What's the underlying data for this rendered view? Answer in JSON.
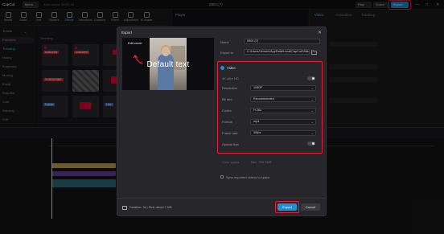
{
  "app": {
    "logo": "CapCut",
    "menu_label": "Menu",
    "autosave": "Auto saved: 18:37:16",
    "document_title": "0904 (7)",
    "play_label": "Play",
    "share_label": "Share",
    "export_label": "Export",
    "window_controls": [
      "—",
      "□",
      "✕"
    ]
  },
  "media_toolbar": {
    "items": [
      "Media",
      "Audio",
      "Text",
      "Stickers",
      "Effects",
      "Transitions",
      "Captions",
      "Filters",
      "Adjustment",
      "AI avatar"
    ],
    "active_index": 4
  },
  "sidebar": {
    "top_label": "Trends",
    "items": [
      "Favorites",
      "Trending",
      "Hobby",
      "Emphasis",
      "Moving",
      "Emoji",
      "Surprise",
      "Cute",
      "Dancing",
      "Y2K"
    ],
    "selected_index": 1
  },
  "effects_grid": {
    "section_label": "Trending",
    "tiles": [
      {
        "label": "subscribe",
        "color": "#3a3a40"
      },
      {
        "label": "subscribe",
        "color": "#333338"
      },
      {
        "label": "",
        "color": "#3a3338"
      },
      {
        "label": "SUBSCRIBE",
        "color": "#2f2f34"
      },
      {
        "label": "",
        "color": "#5a5a5a"
      },
      {
        "label": "",
        "color": "#2f2f34"
      },
      {
        "label": "Follow",
        "color": "#2e3a4a"
      },
      {
        "label": "",
        "color": "#3b2e30"
      },
      {
        "label": "Like",
        "color": "#2f2f34"
      }
    ]
  },
  "player": {
    "label": "Player"
  },
  "right_panel": {
    "tabs": [
      "Video",
      "Animation",
      "Tracking"
    ],
    "selected_tab": 0
  },
  "export_dialog": {
    "title": "Export",
    "close_symbol": "✕",
    "cover_button": "Edit cover",
    "preview_text": "Default text",
    "name_label": "Name",
    "name_value": "0904 (7)",
    "export_to_label": "Export to",
    "export_to_value": "C:/Users/Jensen/AppData/Local/CapCut/Videos",
    "video_section": {
      "title": "Video",
      "enabled": true,
      "ultra_hd_label": "4K ultra HD",
      "resolution_label": "Resolution",
      "resolution_value": "1080P",
      "bitrate_label": "Bit rate",
      "bitrate_value": "Recommended",
      "codec_label": "Codec",
      "codec_value": "H.264",
      "format_label": "Format",
      "format_value": "mp4",
      "framerate_label": "Frame rate",
      "framerate_value": "30fps",
      "optical_flow_label": "Optical flow"
    },
    "color_space_label": "Color space",
    "color_space_value": "Rec. 709 SDR",
    "sync_label": "Sync exported videos to space",
    "duration_text": "Duration: 3s | Size: about 7 MB",
    "export_button": "Export",
    "cancel_button": "Cancel"
  },
  "colors": {
    "accent": "#1f8fd6",
    "highlight": "#e0203a",
    "background": "#141416"
  }
}
